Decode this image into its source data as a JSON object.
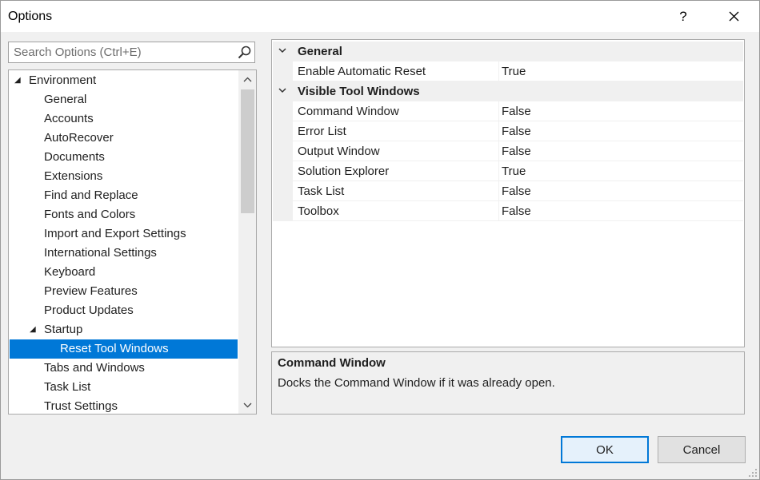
{
  "window": {
    "title": "Options",
    "help_label": "?",
    "close_label": "✕"
  },
  "search": {
    "placeholder": "Search Options (Ctrl+E)",
    "value": ""
  },
  "tree": {
    "items": [
      {
        "label": "Environment",
        "expander": "◢",
        "selected": false
      },
      {
        "label": "General"
      },
      {
        "label": "Accounts"
      },
      {
        "label": "AutoRecover"
      },
      {
        "label": "Documents"
      },
      {
        "label": "Extensions"
      },
      {
        "label": "Find and Replace"
      },
      {
        "label": "Fonts and Colors"
      },
      {
        "label": "Import and Export Settings"
      },
      {
        "label": "International Settings"
      },
      {
        "label": "Keyboard"
      },
      {
        "label": "Preview Features"
      },
      {
        "label": "Product Updates"
      },
      {
        "label": "Startup",
        "expander": "◢"
      },
      {
        "label": "Reset Tool Windows",
        "selected": true
      },
      {
        "label": "Tabs and Windows"
      },
      {
        "label": "Task List"
      },
      {
        "label": "Trust Settings"
      }
    ]
  },
  "grid": {
    "categories": [
      {
        "name": "General",
        "properties": [
          {
            "name": "Enable Automatic Reset",
            "value": "True"
          }
        ]
      },
      {
        "name": "Visible Tool Windows",
        "properties": [
          {
            "name": "Command Window",
            "value": "False"
          },
          {
            "name": "Error List",
            "value": "False"
          },
          {
            "name": "Output Window",
            "value": "False"
          },
          {
            "name": "Solution Explorer",
            "value": "True"
          },
          {
            "name": "Task List",
            "value": "False"
          },
          {
            "name": "Toolbox",
            "value": "False"
          }
        ]
      }
    ]
  },
  "description": {
    "title": "Command Window",
    "text": "Docks the Command Window if it was already open."
  },
  "buttons": {
    "ok": "OK",
    "cancel": "Cancel"
  },
  "colors": {
    "selection": "#0078d7",
    "panel_bg": "#f0f0f0",
    "primary_border": "#0078d7"
  }
}
